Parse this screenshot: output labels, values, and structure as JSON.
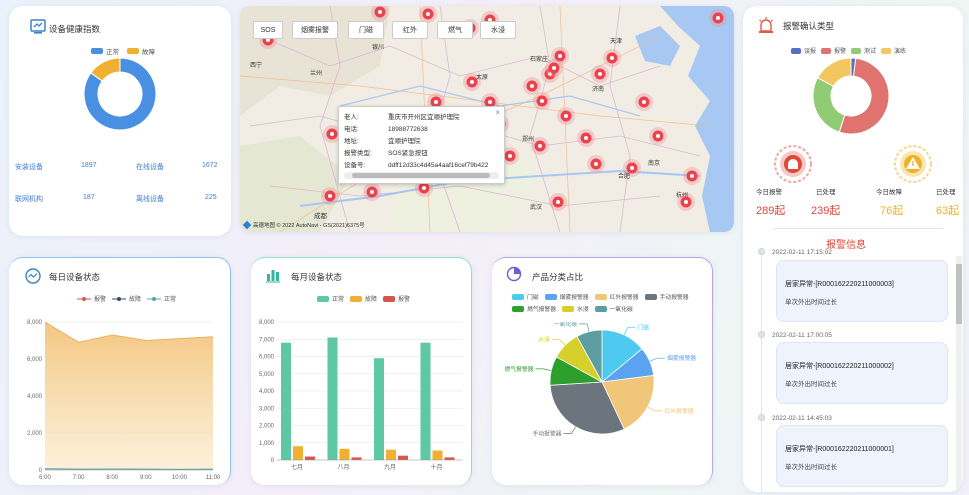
{
  "health": {
    "title": "设备健康指数",
    "legend": [
      "正常",
      "故障"
    ],
    "chart_data": {
      "type": "pie",
      "categories": [
        "正常",
        "故障"
      ],
      "values": [
        85,
        15
      ]
    },
    "stats": [
      {
        "label": "安装设备",
        "value": "1897"
      },
      {
        "label": "在线设备",
        "value": "1672"
      },
      {
        "label": "联网机构",
        "value": "187"
      },
      {
        "label": "离线设备",
        "value": "225"
      }
    ]
  },
  "map": {
    "buttons": [
      "SOS",
      "烟雾报警",
      "门磁",
      "红外",
      "燃气",
      "水浸"
    ],
    "popup": {
      "close": "×",
      "rows": [
        {
          "k": "老人:",
          "v": "重庆市开州区宜顺护理院"
        },
        {
          "k": "电话:",
          "v": "18988772638"
        },
        {
          "k": "地址:",
          "v": "宜顺护理院"
        },
        {
          "k": "报警类型:",
          "v": "SOS紧急按钮"
        },
        {
          "k": "设备号:",
          "v": "ddff12d33c4d45a4aaf16cef79b422"
        }
      ]
    },
    "cities": {
      "xining": "西宁",
      "lanzhou": "兰州",
      "chengdu": "成都",
      "tianjin": "天津",
      "jinan": "济南",
      "nanjing": "南京",
      "hefei": "合肥",
      "hangzhou": "杭州",
      "zhengzhou": "郑州",
      "xian": "西安",
      "wuhan": "武汉",
      "yinchuan": "银川",
      "taiyuan": "太原",
      "shijiazhuang": "石家庄"
    },
    "copyright": "高德地图 © 2022 AutoNavi - GS(2021)6375号"
  },
  "alarm_type": {
    "title": "报警确认类型",
    "legend": [
      "误报",
      "报警",
      "测试",
      "演练"
    ],
    "colors": [
      "#5470c6",
      "#e0726f",
      "#91cc75",
      "#f3c65f"
    ],
    "chart_data": {
      "type": "pie",
      "categories": [
        "误报",
        "报警",
        "测试",
        "演练"
      ],
      "values": [
        2,
        53,
        28,
        17
      ]
    },
    "stats": [
      {
        "label": "今日报警",
        "value": "289起"
      },
      {
        "label": "已处理",
        "value": "239起"
      },
      {
        "label": "今日故障",
        "value": "76起"
      },
      {
        "label": "已处理",
        "value": "63起"
      }
    ]
  },
  "alarm_info": {
    "title": "报警信息",
    "items": [
      {
        "time": "2022-02-11 17:15:02",
        "title": "居家异常-[R000162220211000003]",
        "desc": "单次外出时间过长"
      },
      {
        "time": "2022-02-11 17:00:05",
        "title": "居家异常-[R000162220211000002]",
        "desc": "单次外出时间过长"
      },
      {
        "time": "2022-02-11 14:45:03",
        "title": "居家异常-[R000162220211000001]",
        "desc": "单次外出时间过长"
      }
    ]
  },
  "daily": {
    "title": "每日设备状态",
    "chart_data": {
      "type": "area",
      "x": [
        "6:00",
        "7:00",
        "8:00",
        "9:00",
        "10:00",
        "11:00"
      ],
      "series": [
        {
          "name": "报警",
          "values": [
            0,
            0,
            0,
            0,
            0,
            0
          ]
        },
        {
          "name": "故障",
          "values": [
            8000,
            6900,
            7300,
            7000,
            7100,
            7200
          ]
        },
        {
          "name": "正常",
          "values": [
            60,
            40,
            50,
            40,
            30,
            40
          ]
        }
      ],
      "yticks": [
        "0",
        "2,000",
        "4,000",
        "6,000",
        "8,000"
      ],
      "ylim": [
        0,
        8000
      ]
    }
  },
  "monthly": {
    "title": "每月设备状态",
    "chart_data": {
      "type": "bar",
      "categories": [
        "七月",
        "八月",
        "九月",
        "十月"
      ],
      "series": [
        {
          "name": "正常",
          "values": [
            6800,
            7100,
            5900,
            6800
          ]
        },
        {
          "name": "故障",
          "values": [
            800,
            650,
            600,
            550
          ]
        },
        {
          "name": "报警",
          "values": [
            200,
            150,
            250,
            150
          ]
        }
      ],
      "yticks": [
        "0",
        "1,000",
        "2,000",
        "3,000",
        "4,000",
        "5,000",
        "6,000",
        "7,000",
        "8,000"
      ],
      "ylim": [
        0,
        8000
      ]
    }
  },
  "product": {
    "title": "产品分类占比",
    "chart_data": {
      "type": "pie",
      "categories": [
        "门磁",
        "烟雾报警器",
        "红外报警器",
        "手动报警器",
        "燃气报警器",
        "水浸",
        "一氧化碳"
      ],
      "values": [
        14,
        9,
        20,
        31,
        9,
        9,
        8
      ],
      "colors": [
        "#4ec9f0",
        "#5aa3f0",
        "#f0c679",
        "#6c757d",
        "#2c9f2c",
        "#d6cf2c",
        "#5e9ea0"
      ]
    }
  }
}
